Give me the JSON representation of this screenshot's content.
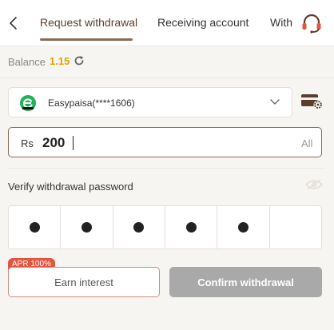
{
  "header": {
    "tabs": [
      {
        "label": "Request withdrawal",
        "active": true
      },
      {
        "label": "Receiving account",
        "active": false
      },
      {
        "label": "With",
        "active": false
      }
    ],
    "back_icon": "chevron-left-icon",
    "support_icon": "headset-icon"
  },
  "balance": {
    "label": "Balance",
    "value": "1.15",
    "refresh_icon": "refresh-icon"
  },
  "account": {
    "provider_icon": "easypaisa-logo",
    "name": "Easypaisa(****1606)",
    "dropdown_icon": "chevron-down-icon",
    "manage_icon": "card-settings-icon"
  },
  "amount": {
    "currency": "Rs",
    "value": "200",
    "all_label": "All"
  },
  "password": {
    "label": "Verify withdrawal password",
    "visibility_icon": "eye-off-icon",
    "digits_filled": 5,
    "digits_total": 6
  },
  "actions": {
    "apr_badge": "APR 100%",
    "earn_label": "Earn interest",
    "confirm_label": "Confirm withdrawal"
  },
  "colors": {
    "accent": "#8b6a55",
    "balance": "#d9a400",
    "badge": "#e4553f",
    "confirm_disabled": "#a9a9a9",
    "easypaisa_green": "#1fb25a"
  }
}
